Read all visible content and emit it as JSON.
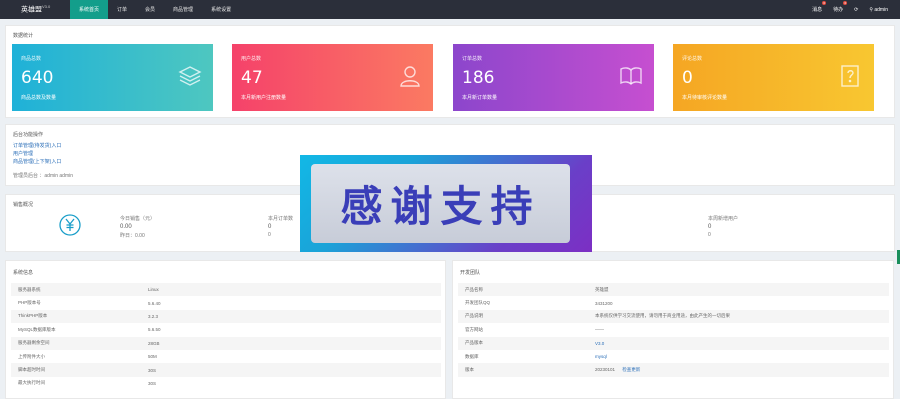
{
  "topbar": {
    "brand": "英雄盟",
    "brand_version": "V3.0",
    "nav": [
      "系统首页",
      "订单",
      "会员",
      "商品管理",
      "系统设置"
    ],
    "right": [
      {
        "label": "消息",
        "badge": "0"
      },
      {
        "label": "待办",
        "badge": "0"
      },
      {
        "label": "⟳",
        "badge": ""
      },
      {
        "label": "admin",
        "badge": ""
      }
    ]
  },
  "overview": {
    "title": "数据统计",
    "cards": [
      {
        "label": "商品总数",
        "value": "640",
        "desc": "商品总数及数量",
        "color_from": "#1fb1d8",
        "color_to": "#4ec7c0",
        "icon": "stack-icon"
      },
      {
        "label": "用户总数",
        "value": "47",
        "desc": "本月新用户注册数量",
        "color_from": "#f5426a",
        "color_to": "#fb7a62",
        "icon": "user-icon"
      },
      {
        "label": "订单总数",
        "value": "186",
        "desc": "本月新订单数量",
        "color_from": "#8c46cc",
        "color_to": "#c64fd0",
        "icon": "book-icon"
      },
      {
        "label": "评论总数",
        "value": "0",
        "desc": "本月待审核评论数量",
        "color_from": "#f5a623",
        "color_to": "#f8c731",
        "icon": "question-icon"
      }
    ]
  },
  "shortcuts": {
    "title": "后台功能操作",
    "links": [
      "订单管理(待发货)入口",
      "用户管理",
      "商品管理(上下架)入口"
    ],
    "note": "管理员后台 ：admin admin"
  },
  "sales": {
    "title": "销售概况",
    "icon": "yen-icon",
    "columns": [
      {
        "label": "今日销售（元）",
        "value": "0.00",
        "sub": "昨日：0.00"
      },
      {
        "label": "本月订单数",
        "value": "0",
        "sub": "0"
      },
      {
        "label": "本周新增用户",
        "value": "0",
        "sub": "0"
      }
    ]
  },
  "sysinfo": {
    "title": "系统信息",
    "rows": [
      [
        "服务器系统",
        "Linux"
      ],
      [
        "PHP版本号",
        "5.6.40"
      ],
      [
        "ThinkPHP版本",
        "3.2.3"
      ],
      [
        "MySQL数据库版本",
        "5.6.50"
      ],
      [
        "服务器剩余空间",
        "28GB"
      ],
      [
        "上传附件大小",
        "50M"
      ],
      [
        "脚本超时时间",
        "30S"
      ],
      [
        "最大执行时间",
        "30S"
      ]
    ]
  },
  "teaminfo": {
    "title": "开发团队",
    "rows": [
      [
        "产品名称",
        "英雄盟"
      ],
      [
        "开发团队QQ",
        "3431200"
      ],
      [
        "产品说明",
        "本系统仅供学习交流使用，请勿用于商业用途，由此产生的一切后果"
      ],
      [
        "官方网站",
        "——"
      ],
      [
        "产品版本",
        "V3.0"
      ],
      [
        "数据库",
        "mysql"
      ],
      [
        "版本",
        "20230101",
        "检查更新"
      ]
    ]
  },
  "banner": {
    "text": "感谢支持"
  }
}
